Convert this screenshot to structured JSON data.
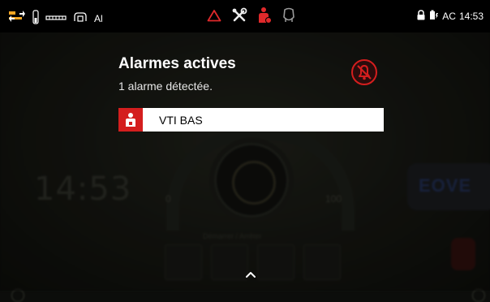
{
  "status_bar": {
    "left_label": "Al",
    "battery_label": "AC",
    "time": "14:53"
  },
  "background_app": {
    "clock": "14:53",
    "dial_min": "0",
    "dial_max": "100",
    "start_stop_label": "Démarrer / Arrêter",
    "brand": "EOVE"
  },
  "alarm_panel": {
    "title": "Alarmes actives",
    "subtitle": "1 alarme détectée.",
    "alarms": [
      {
        "label": "VTI BAS",
        "severity_color": "#d41e1e"
      }
    ]
  },
  "colors": {
    "alarm_red": "#d41e1e",
    "status_bar_bg": "#000000"
  }
}
